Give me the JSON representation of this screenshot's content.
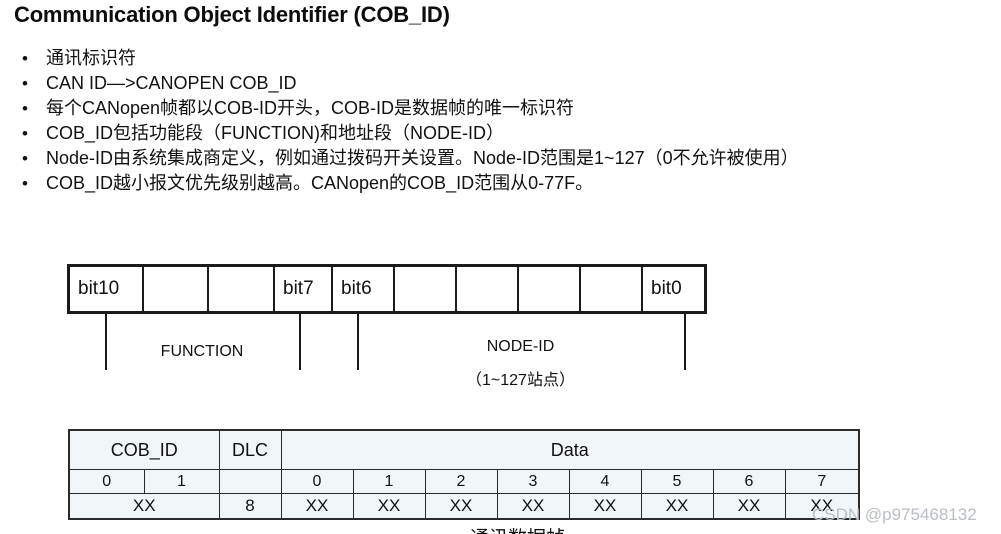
{
  "slide": {
    "title": "Communication Object Identifier (COB_ID)"
  },
  "bullets": {
    "marker": "•",
    "items": [
      {
        "text": "通讯标识符"
      },
      {
        "text": "CAN  ID—>CANOPEN    COB_ID"
      },
      {
        "text": "每个CANopen帧都以COB-ID开头，COB-ID是数据帧的唯一标识符"
      },
      {
        "text": "COB_ID包括功能段（FUNCTION)和地址段（NODE-ID）"
      },
      {
        "text": "Node-ID由系统集成商定义，例如通过拨码开关设置。Node-ID范围是1~127（0不允许被使用）"
      },
      {
        "text": "COB_ID越小报文优先级别越高。CANopen的COB_ID范围从0-77F。"
      }
    ]
  },
  "bit_table": {
    "cells": [
      {
        "label": "bit10"
      },
      {
        "label": ""
      },
      {
        "label": ""
      },
      {
        "label": "bit7"
      },
      {
        "label": "bit6"
      },
      {
        "label": ""
      },
      {
        "label": ""
      },
      {
        "label": ""
      },
      {
        "label": ""
      },
      {
        "label": "bit0"
      }
    ]
  },
  "bit_brace": {
    "function_label": "FUNCTION",
    "node_id_label": "NODE-ID",
    "node_id_sub": "（1~127站点）"
  },
  "frame_table": {
    "headers": {
      "cob_id": "COB_ID",
      "dlc": "DLC",
      "data": "Data"
    },
    "cob_id_index": [
      "0",
      "1"
    ],
    "data_index": [
      "0",
      "1",
      "2",
      "3",
      "4",
      "5",
      "6",
      "7"
    ],
    "values": {
      "cob_id": "XX",
      "dlc": "8",
      "data": [
        "XX",
        "XX",
        "XX",
        "XX",
        "XX",
        "XX",
        "XX",
        "XX"
      ]
    }
  },
  "caption": {
    "clipped_text": "通讯数据帧"
  },
  "watermark": {
    "text": "CSDN @p975468132"
  },
  "colors": {
    "xx_red": "#e8231a",
    "table_bg": "#f1f6f8",
    "border": "#2b2b2b",
    "watermark": "#b9bec4"
  }
}
